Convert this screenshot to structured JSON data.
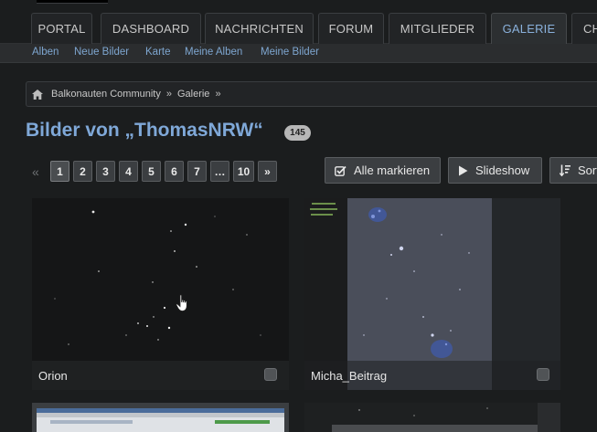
{
  "main_nav": {
    "tabs": [
      {
        "label": "PORTAL",
        "active": false
      },
      {
        "label": "DASHBOARD",
        "active": false
      },
      {
        "label": "NACHRICHTEN",
        "active": false
      },
      {
        "label": "FORUM",
        "active": false
      },
      {
        "label": "MITGLIEDER",
        "active": false
      },
      {
        "label": "GALERIE",
        "active": true
      },
      {
        "label": "CH",
        "active": false
      }
    ]
  },
  "sub_nav": {
    "links": [
      "Alben",
      "Neue Bilder",
      "Karte",
      "Meine Alben",
      "Meine Bilder"
    ]
  },
  "breadcrumb": {
    "items": [
      "Balkonauten Community",
      "Galerie"
    ],
    "separator": "»",
    "home_icon": "home-icon"
  },
  "page": {
    "title": "Bilder von „ThomasNRW“",
    "count": "145"
  },
  "pagination": {
    "prev_icon": "«",
    "pages": [
      "1",
      "2",
      "3",
      "4",
      "5",
      "6",
      "7",
      "…",
      "10"
    ],
    "current": "1",
    "next_icon": "»"
  },
  "actions": {
    "mark_all": "Alle markieren",
    "slideshow": "Slideshow",
    "sort": "Sort"
  },
  "gallery": {
    "items": [
      {
        "caption": "Orion"
      },
      {
        "caption": "Micha_Beitrag"
      }
    ]
  },
  "colors": {
    "background": "#1b1d1e",
    "link": "#7ea6d0",
    "title": "#7fa8d8",
    "active_tab": "#8ab1dc"
  }
}
